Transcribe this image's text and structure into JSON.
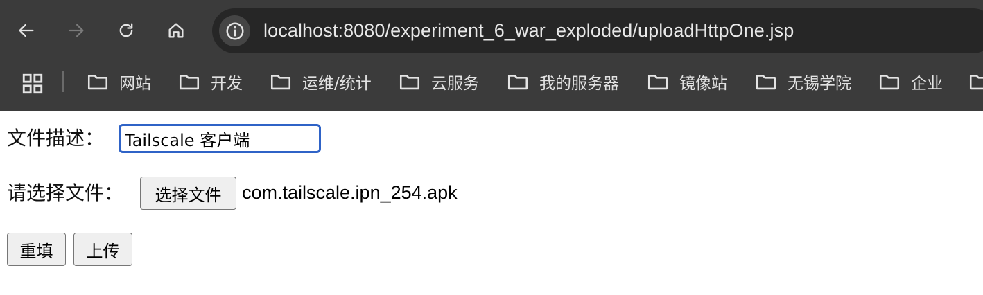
{
  "browser": {
    "url": "localhost:8080/experiment_6_war_exploded/uploadHttpOne.jsp",
    "icons": {
      "back": "arrow-left-icon",
      "forward": "arrow-right-icon",
      "reload": "reload-icon",
      "home": "home-icon",
      "site_info": "info-icon",
      "apps": "apps-grid-icon",
      "bookmark_folder": "folder-icon"
    },
    "colors": {
      "chrome_bg": "#3b3b3b",
      "omnibox_bg": "#262626",
      "url_text": "#e8e8e8",
      "forward_disabled": "#7a7a7a"
    }
  },
  "bookmarks": [
    {
      "label": "网站"
    },
    {
      "label": "开发"
    },
    {
      "label": "运维/统计"
    },
    {
      "label": "云服务"
    },
    {
      "label": "我的服务器"
    },
    {
      "label": "镜像站"
    },
    {
      "label": "无锡学院"
    },
    {
      "label": "企业"
    },
    {
      "label": ""
    }
  ],
  "form": {
    "description_label": "文件描述：",
    "description_value": "Tailscale 客户端",
    "file_label": "请选择文件：",
    "file_button_label": "选择文件",
    "file_name": "com.tailscale.ipn_254.apk",
    "reset_label": "重填",
    "submit_label": "上传",
    "colors": {
      "input_focus_border": "#2f63c7",
      "button_bg": "#efefef",
      "button_border": "#767676"
    }
  }
}
